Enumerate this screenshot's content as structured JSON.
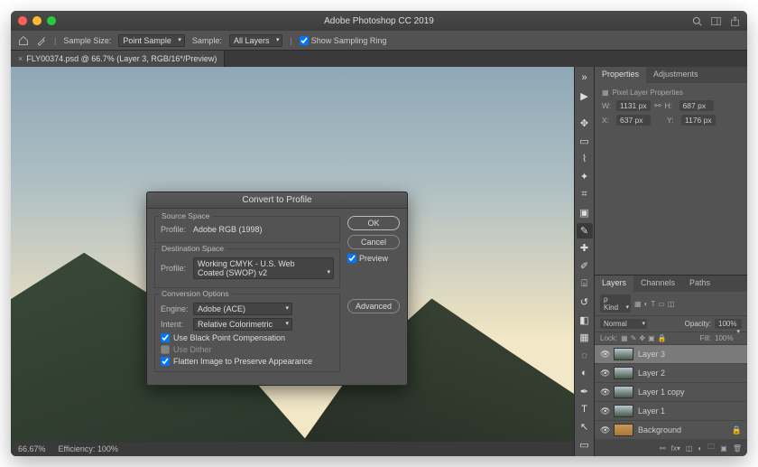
{
  "app": {
    "title": "Adobe Photoshop CC 2019"
  },
  "options_bar": {
    "sample_size_label": "Sample Size:",
    "sample_size_value": "Point Sample",
    "sample_label": "Sample:",
    "sample_value": "All Layers",
    "show_sampling_ring_label": "Show Sampling Ring",
    "show_sampling_ring_checked": true
  },
  "document": {
    "tab_title": "FLY00374.psd @ 66.7% (Layer 3, RGB/16*/Preview)",
    "zoom": "66.67%",
    "efficiency": "Efficiency: 100%"
  },
  "properties": {
    "tabs": [
      "Properties",
      "Adjustments"
    ],
    "heading": "Pixel Layer Properties",
    "w_label": "W:",
    "w_value": "1131 px",
    "h_label": "H:",
    "h_value": "687 px",
    "x_label": "X:",
    "x_value": "637 px",
    "y_label": "Y:",
    "y_value": "1176 px"
  },
  "layers_panel": {
    "tabs": [
      "Layers",
      "Channels",
      "Paths"
    ],
    "kind_label": "Kind",
    "blend_mode": "Normal",
    "opacity_label": "Opacity:",
    "opacity_value": "100%",
    "lock_label": "Lock:",
    "fill_label": "Fill:",
    "fill_value": "100%",
    "layers": [
      {
        "name": "Layer 3",
        "selected": true
      },
      {
        "name": "Layer 2",
        "selected": false
      },
      {
        "name": "Layer 1 copy",
        "selected": false
      },
      {
        "name": "Layer 1",
        "selected": false
      },
      {
        "name": "Background",
        "selected": false,
        "locked": true,
        "bg": true
      }
    ]
  },
  "dialog": {
    "title": "Convert to Profile",
    "source_space_legend": "Source Space",
    "profile_label": "Profile:",
    "source_profile": "Adobe RGB (1998)",
    "destination_space_legend": "Destination Space",
    "destination_profile": "Working CMYK - U.S. Web Coated (SWOP) v2",
    "conversion_options_legend": "Conversion Options",
    "engine_label": "Engine:",
    "engine_value": "Adobe (ACE)",
    "intent_label": "Intent:",
    "intent_value": "Relative Colorimetric",
    "use_bpc_label": "Use Black Point Compensation",
    "use_bpc_checked": true,
    "use_dither_label": "Use Dither",
    "use_dither_checked": false,
    "flatten_label": "Flatten Image to Preserve Appearance",
    "flatten_checked": true,
    "ok_label": "OK",
    "cancel_label": "Cancel",
    "preview_label": "Preview",
    "preview_checked": true,
    "advanced_label": "Advanced"
  }
}
